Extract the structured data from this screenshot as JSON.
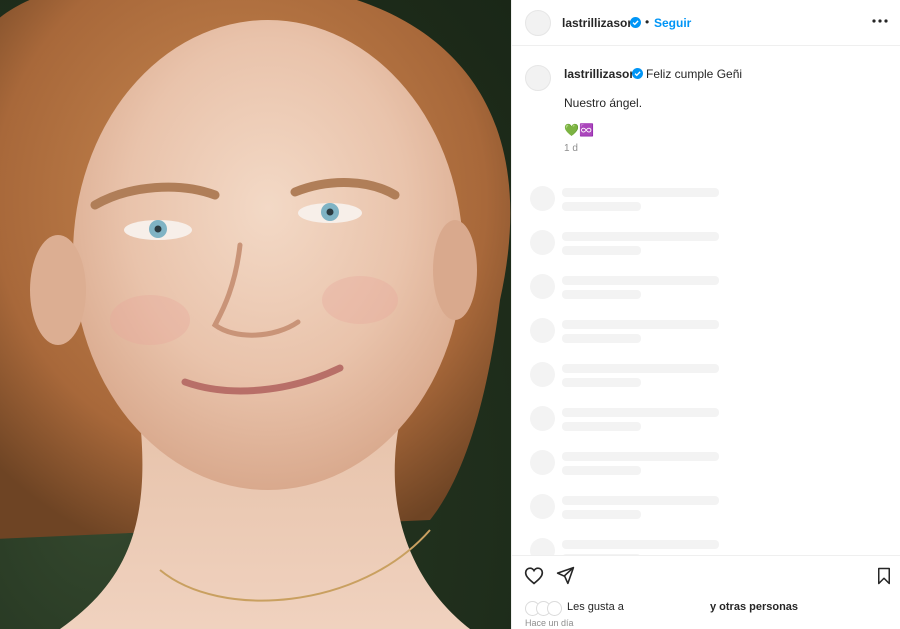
{
  "post": {
    "username": "lastrillizasoro",
    "follow_label": "Seguir",
    "separator": "•"
  },
  "caption": {
    "username": "lastrillizasoro",
    "line1": "Feliz cumple Geñi",
    "line2": "Nuestro ángel.",
    "emojis": "💚♾️",
    "time": "1 d"
  },
  "likes": {
    "prefix": "Les gusta a",
    "suffix": "y otras personas",
    "date": "Hace un día"
  },
  "colors": {
    "accent": "#0095f6",
    "verified": "#0095f6",
    "skeleton": "#f3f3f3",
    "heart_emoji": "#3aa36f"
  },
  "icons": [
    "verified-badge-icon",
    "more-options-icon",
    "heart-icon",
    "share-icon",
    "bookmark-icon"
  ]
}
